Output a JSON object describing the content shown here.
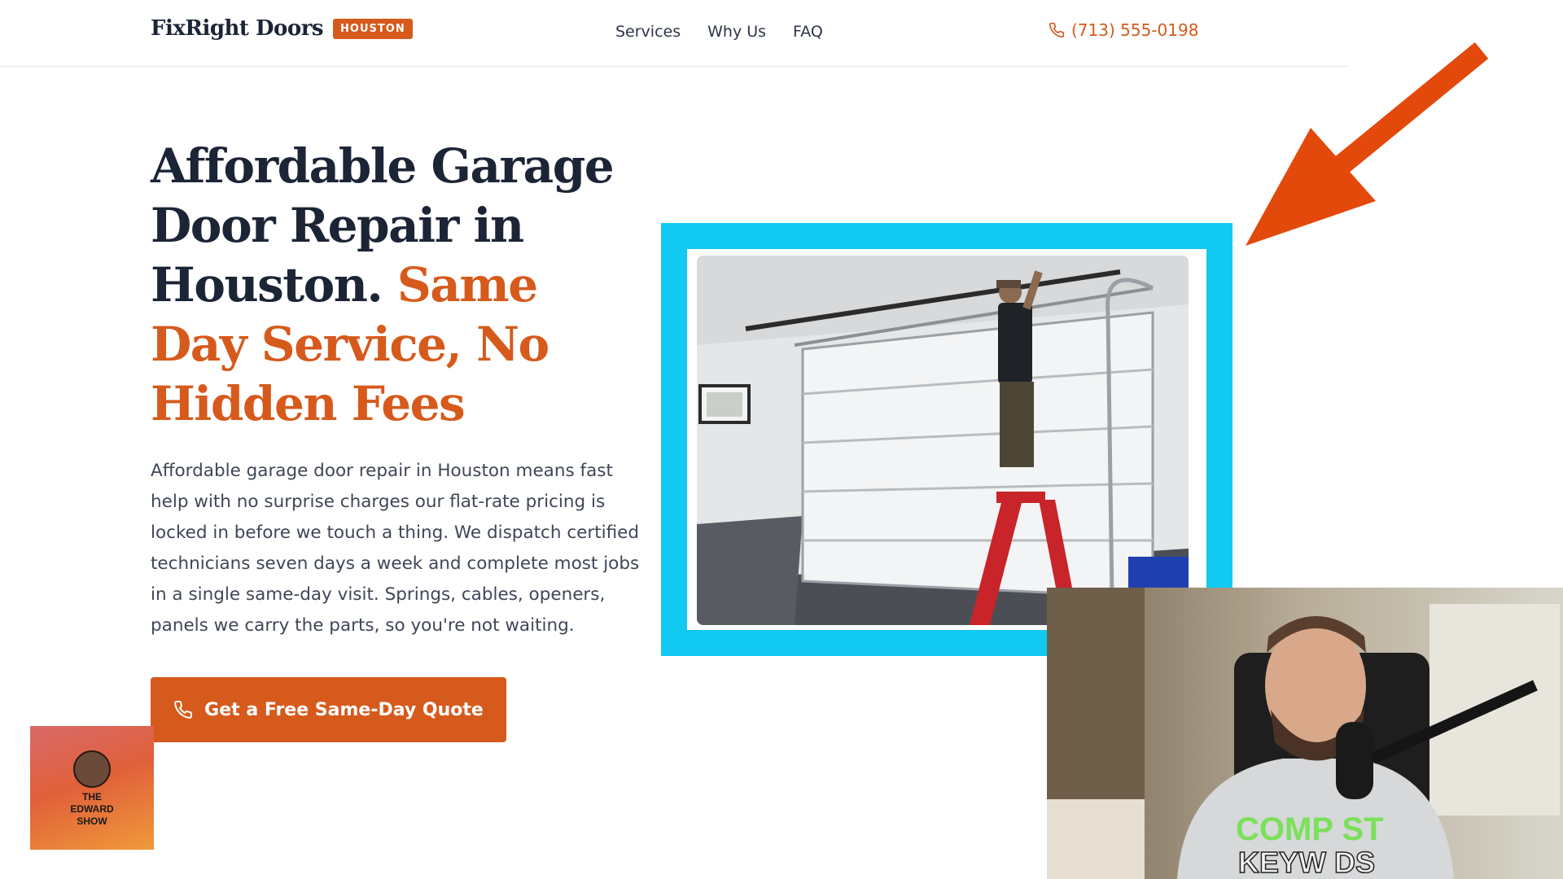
{
  "header": {
    "brand_name": "FixRight Doors",
    "city_badge": "HOUSTON",
    "nav": [
      "Services",
      "Why Us",
      "FAQ"
    ],
    "phone": "(713) 555-0198"
  },
  "hero": {
    "title_dark": "Affordable Garage Door Repair in Houston.",
    "title_accent": "Same Day Service, No Hidden Fees",
    "description": "Affordable garage door repair in Houston means fast help with no surprise charges our flat-rate pricing is locked in before we touch a thing. We dispatch certified technicians seven days a week and complete most jobs in a single same-day visit. Springs, cables, openers, panels we carry the parts, so you're not waiting.",
    "cta_label": "Get a Free Same-Day Quote"
  },
  "overlay": {
    "show_logo_text": [
      "THE",
      "EDWARD",
      "SHOW"
    ],
    "webcam_shirt_text_1": "COMP ST",
    "webcam_shirt_text_2": "KEYW DS"
  },
  "colors": {
    "accent": "#d65a1c",
    "frame_cyan": "#12c9f2",
    "arrow": "#e4490c",
    "heading": "#1c2536"
  },
  "icons": {
    "phone": "phone-icon",
    "arrow": "arrow-annotation"
  }
}
